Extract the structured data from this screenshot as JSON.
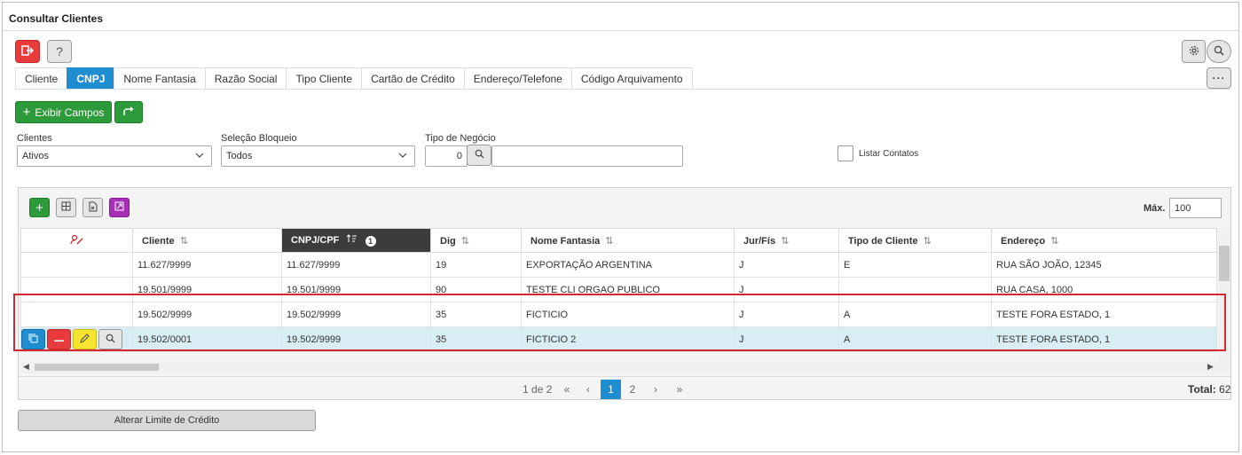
{
  "window": {
    "title": "Consultar Clientes"
  },
  "tabs": [
    {
      "label": "Cliente",
      "active": false
    },
    {
      "label": "CNPJ",
      "active": true
    },
    {
      "label": "Nome Fantasia",
      "active": false
    },
    {
      "label": "Razão Social",
      "active": false
    },
    {
      "label": "Tipo Cliente",
      "active": false
    },
    {
      "label": "Cartão de Crédito",
      "active": false
    },
    {
      "label": "Endereço/Telefone",
      "active": false
    },
    {
      "label": "Código Arquivamento",
      "active": false
    }
  ],
  "toolbar": {
    "show_fields_label": "Exibir Campos"
  },
  "filters": {
    "clientes_label": "Clientes",
    "clientes_value": "Ativos",
    "bloqueio_label": "Seleção Bloqueio",
    "bloqueio_value": "Todos",
    "negocio_label": "Tipo de Negócio",
    "negocio_value": "0",
    "contatos_label": "Listar Contatos"
  },
  "grid": {
    "max_label": "Máx.",
    "max_value": "100",
    "columns": [
      {
        "label": "Cliente",
        "sort_icon": "⇅"
      },
      {
        "label": "CNPJ/CPF",
        "sort_icon": "sort-asc",
        "sort_order": "1"
      },
      {
        "label": "Dig",
        "sort_icon": "⇅"
      },
      {
        "label": "Nome Fantasia",
        "sort_icon": "⇅"
      },
      {
        "label": "Jur/Fís",
        "sort_icon": "⇅"
      },
      {
        "label": "Tipo de Cliente",
        "sort_icon": "⇅"
      },
      {
        "label": "Endereço",
        "sort_icon": "⇅"
      }
    ],
    "rows": [
      {
        "cliente": "11.627/9999",
        "cnpj": "11.627/9999",
        "dig": "19",
        "fantasia": "EXPORTAÇÃO ARGENTINA",
        "jur": "J",
        "tipo": "E",
        "endereco": "RUA SÃO JOÃO, 12345"
      },
      {
        "cliente": "19.501/9999",
        "cnpj": "19.501/9999",
        "dig": "90",
        "fantasia": "TESTE CLI ORGAO PUBLICO",
        "jur": "J",
        "tipo": "",
        "endereco": "RUA CASA, 1000"
      },
      {
        "cliente": "19.502/9999",
        "cnpj": "19.502/9999",
        "dig": "35",
        "fantasia": "FICTICIO",
        "jur": "J",
        "tipo": "A",
        "endereco": "TESTE FORA ESTADO, 1"
      },
      {
        "cliente": "19.502/0001",
        "cnpj": "19.502/9999",
        "dig": "35",
        "fantasia": "FICTICIO 2",
        "jur": "J",
        "tipo": "A",
        "endereco": "TESTE FORA ESTADO, 1"
      }
    ],
    "pager": {
      "page_info": "1 de 2",
      "first": "«",
      "prev": "‹",
      "pages": [
        "1",
        "2"
      ],
      "next": "›",
      "last": "»",
      "total_label": "Total:",
      "total_value": "62"
    }
  },
  "footer": {
    "credit_button": "Alterar Limite de Crédito"
  },
  "colors": {
    "accent": "#1e8ed1",
    "green": "#2e9b3a",
    "red": "#e83b3b",
    "highlight": "#d7262d",
    "selected_row": "#d9eef4"
  }
}
